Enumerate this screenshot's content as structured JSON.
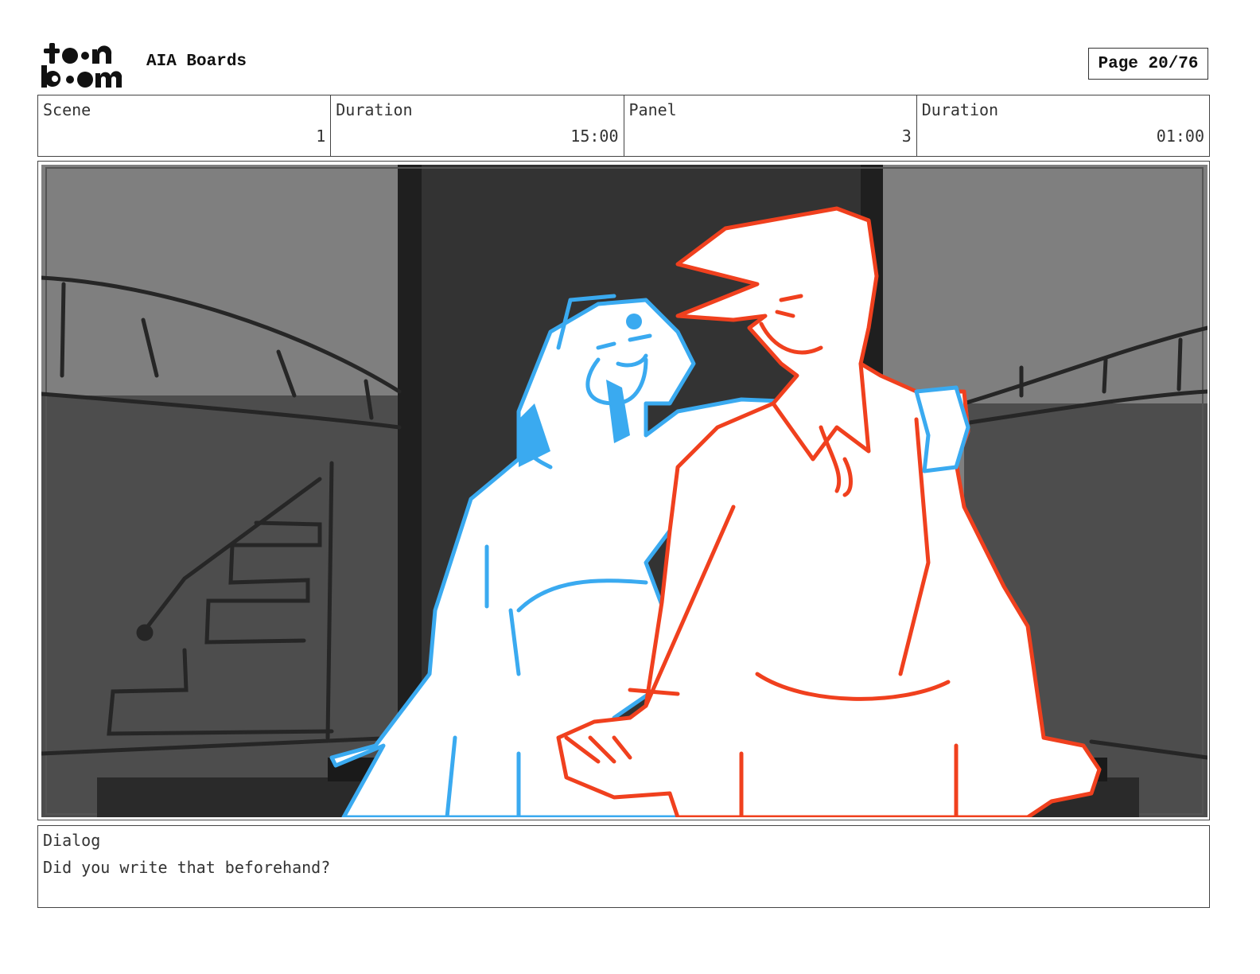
{
  "header": {
    "logo_text_line1": "toon",
    "logo_text_line2": "boom",
    "project_title": "AIA Boards",
    "page_label": "Page 20/76"
  },
  "info": [
    {
      "label": "Scene",
      "value": "1"
    },
    {
      "label": "Duration",
      "value": "15:00"
    },
    {
      "label": "Panel",
      "value": "3"
    },
    {
      "label": "Duration",
      "value": "01:00"
    }
  ],
  "dialog": {
    "label": "Dialog",
    "text": "Did you write that beforehand?"
  },
  "colors": {
    "girl_line": "#3aaaf0",
    "boy_line": "#f0401e",
    "background_dark": "#333333",
    "background_mid": "#7f7f7f"
  }
}
